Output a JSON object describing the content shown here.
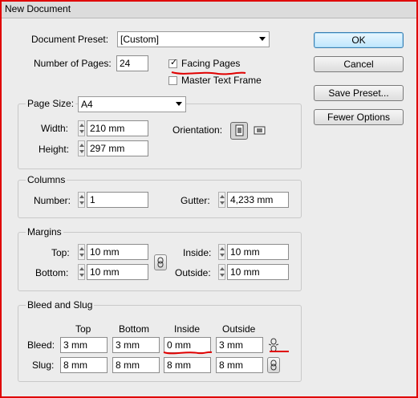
{
  "window": {
    "title": "New Document"
  },
  "preset": {
    "label": "Document Preset:",
    "value": "[Custom]"
  },
  "pages": {
    "label": "Number of Pages:",
    "value": "24"
  },
  "options": {
    "facing_pages": "Facing Pages",
    "master_text_frame": "Master Text Frame",
    "facing_checked": true,
    "master_checked": false
  },
  "buttons": {
    "ok": "OK",
    "cancel": "Cancel",
    "save_preset": "Save Preset...",
    "fewer_options": "Fewer Options"
  },
  "page_size": {
    "label": "Page Size:",
    "value": "A4",
    "width_label": "Width:",
    "width": "210 mm",
    "height_label": "Height:",
    "height": "297 mm",
    "orientation_label": "Orientation:"
  },
  "columns": {
    "title": "Columns",
    "number_label": "Number:",
    "number": "1",
    "gutter_label": "Gutter:",
    "gutter": "4,233 mm"
  },
  "margins": {
    "title": "Margins",
    "top_label": "Top:",
    "top": "10 mm",
    "bottom_label": "Bottom:",
    "bottom": "10 mm",
    "inside_label": "Inside:",
    "inside": "10 mm",
    "outside_label": "Outside:",
    "outside": "10 mm"
  },
  "bleed_slug": {
    "title": "Bleed and Slug",
    "headers": {
      "top": "Top",
      "bottom": "Bottom",
      "inside": "Inside",
      "outside": "Outside"
    },
    "bleed_label": "Bleed:",
    "slug_label": "Slug:",
    "bleed": {
      "top": "3 mm",
      "bottom": "3 mm",
      "inside": "0 mm",
      "outside": "3 mm"
    },
    "slug": {
      "top": "8 mm",
      "bottom": "8 mm",
      "inside": "8 mm",
      "outside": "8 mm"
    }
  },
  "annotations": {
    "color": "#e00000"
  }
}
